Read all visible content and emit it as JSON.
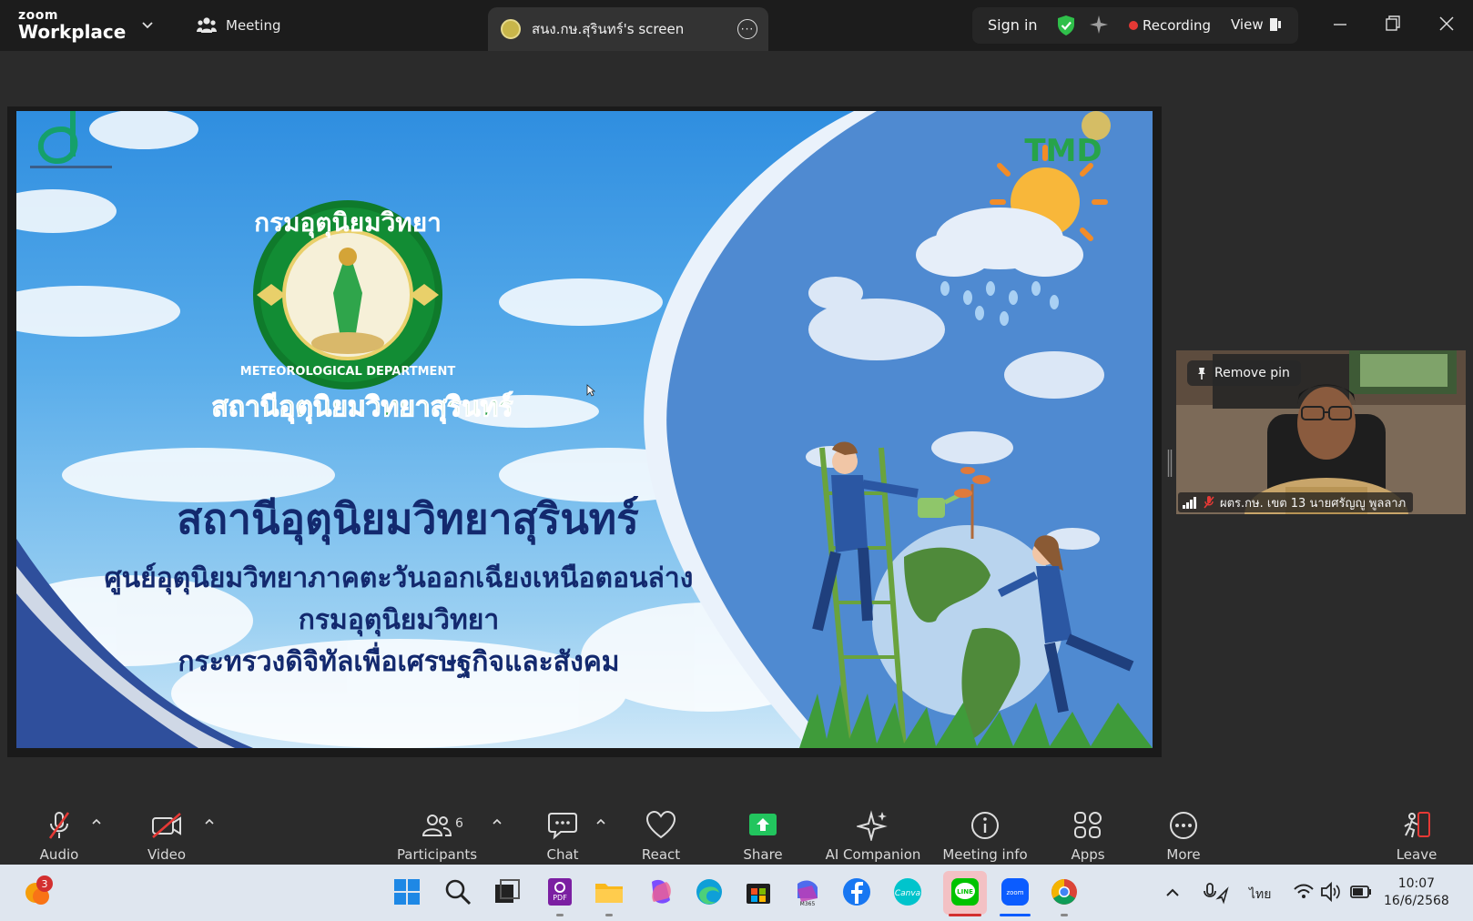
{
  "titlebar": {
    "brand_top": "zoom",
    "brand_bottom": "Workplace",
    "meeting_label": "Meeting",
    "share_tab_label": "สนง.กษ.สุรินทร์'s screen",
    "signin_label": "Sign in",
    "recording_label": "Recording",
    "view_label": "View"
  },
  "slide": {
    "logo_right_text": "TMD",
    "seal_top_text": "กรมอุตุนิยมวิทยา",
    "seal_en_text": "METEOROLOGICAL DEPARTMENT",
    "station_arc_text": "สถานีอุตุนิยมวิทยาสุรินทร์",
    "title_line1": "สถานีอุตุนิยมวิทยาสุรินทร์",
    "title_line2": "ศูนย์อุตุนิยมวิทยาภาคตะวันออกเฉียงเหนือตอนล่าง",
    "title_line3": "กรมอุตุนิยมวิทยา",
    "title_line4": "กระทรวงดิจิทัลเพื่อเศรษฐกิจและสังคม"
  },
  "participant": {
    "remove_pin_label": "Remove pin",
    "name": "ผตร.กษ. เขต 13 นายศรัญญู พูลลาภ"
  },
  "toolbar": {
    "audio_label": "Audio",
    "video_label": "Video",
    "participants_label": "Participants",
    "participants_count": "6",
    "chat_label": "Chat",
    "react_label": "React",
    "share_label": "Share",
    "ai_label": "AI Companion",
    "info_label": "Meeting info",
    "apps_label": "Apps",
    "more_label": "More",
    "leave_label": "Leave"
  },
  "taskbar": {
    "notification_count": "3",
    "language": "ไทย",
    "time": "10:07",
    "date": "16/6/2568",
    "colors": {
      "accent_green": "#00c300",
      "zoom_blue": "#0b5cff",
      "rec_red": "#e53935"
    }
  }
}
